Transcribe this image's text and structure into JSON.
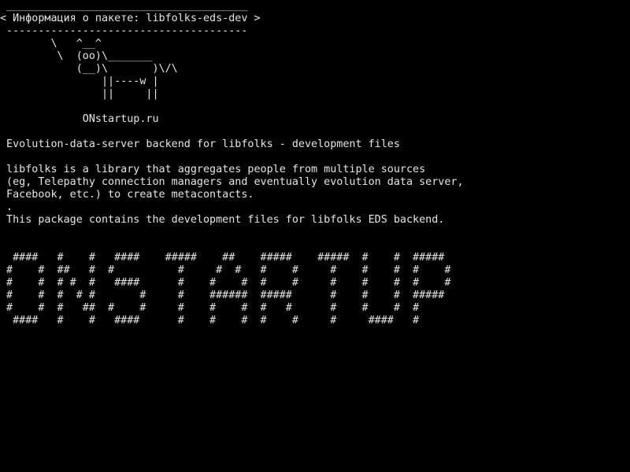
{
  "screen": {
    "background": "#000000",
    "foreground": "#e6e6e6"
  },
  "cowsay": {
    "bubble_top": " ______________________________________",
    "bubble_text": "< Информация о пакете: libfolks-eds-dev >",
    "bubble_bottom": " --------------------------------------",
    "cow": [
      "        \\   ^__^",
      "         \\  (oo)\\_______",
      "            (__)\\       )\\/\\",
      "                ||----w |",
      "                ||     ||"
    ],
    "site": "             ONstartup.ru"
  },
  "description": {
    "summary": " Evolution-data-server backend for libfolks - development files",
    "body": [
      " libfolks is a library that aggregates people from multiple sources",
      " (eg, Telepathy connection managers and eventually evolution data server,",
      " Facebook, etc.) to create metacontacts.",
      " .",
      " This package contains the development files for libfolks EDS backend."
    ]
  },
  "banner": [
    "  ####   #    #   ####    #####    ##    #####    #####  #    #  #####",
    " #    #  ##   #  #          #     #  #   #    #     #    #    #  #    #",
    " #    #  # #  #   ####      #    #    #  #    #     #    #    #  #    #",
    " #    #  #  # #       #     #    ######  #####      #    #    #  #####",
    " #    #  #   ##  #    #     #    #    #  #   #      #    #    #  #",
    "  ####   #    #   ####      #    #    #  #    #     #     ####   #"
  ]
}
